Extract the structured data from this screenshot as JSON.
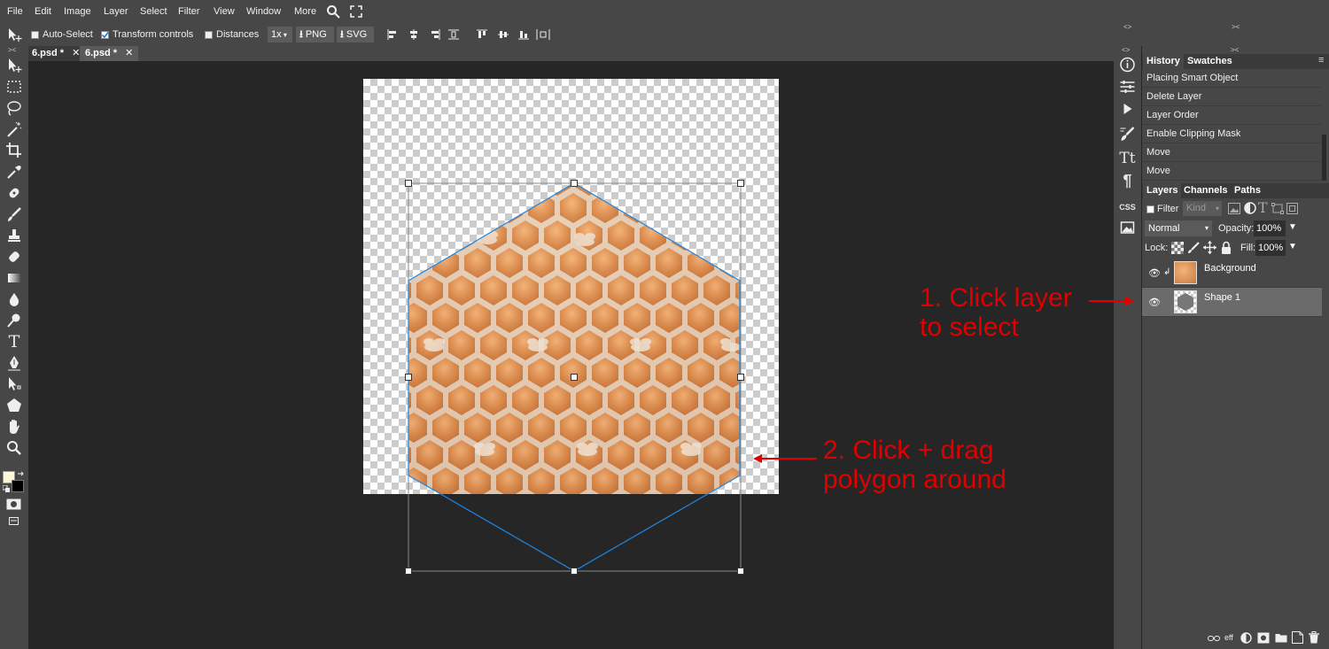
{
  "menu": [
    "File",
    "Edit",
    "Image",
    "Layer",
    "Select",
    "Filter",
    "View",
    "Window",
    "More"
  ],
  "options": {
    "auto_select": "Auto-Select",
    "transform_controls": "Transform controls",
    "distances": "Distances",
    "zoom": "1x",
    "png": "PNG",
    "svg": "SVG"
  },
  "tabs": [
    {
      "label": "6.psd *"
    },
    {
      "label": "6.psd *"
    }
  ],
  "history_panel": {
    "tabs": [
      "History",
      "Swatches"
    ],
    "items": [
      "Placing Smart Object",
      "Delete Layer",
      "Layer Order",
      "Enable Clipping Mask",
      "Move",
      "Move"
    ]
  },
  "layers_panel": {
    "tabs": [
      "Layers",
      "Channels",
      "Paths"
    ],
    "filter_label": "Filter",
    "kind_placeholder": "Kind",
    "blend_mode": "Normal",
    "opacity_label": "Opacity:",
    "opacity_value": "100%",
    "lock_label": "Lock:",
    "fill_label": "Fill:",
    "fill_value": "100%",
    "layers": [
      {
        "name": "Background",
        "selected": false
      },
      {
        "name": "Shape 1",
        "selected": true
      }
    ],
    "footer_link_label": "eff"
  },
  "right_icons": {
    "css_label": "CSS"
  },
  "annotations": {
    "note1_line1": "1. Click layer",
    "note1_line2": "to select",
    "note2_line1": "2. Click + drag",
    "note2_line2": "polygon around"
  },
  "colors": {
    "ui_bg": "#474747",
    "workspace": "#262626",
    "annotation": "#e00000",
    "selection": "#1e88e5",
    "foreground_swatch": "#fff8d6"
  }
}
